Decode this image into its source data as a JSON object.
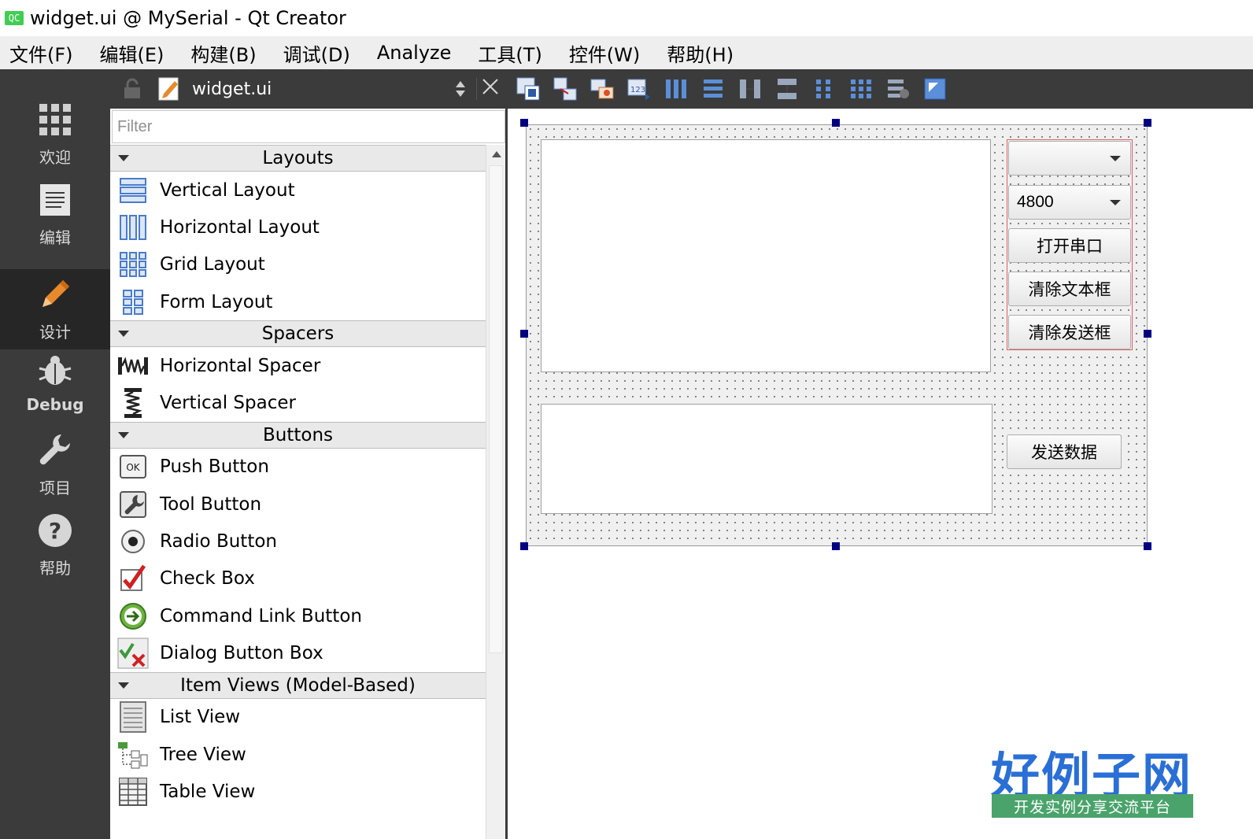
{
  "window": {
    "title": "widget.ui @ MySerial - Qt Creator",
    "app_badge": "QC"
  },
  "menu": [
    "文件(F)",
    "编辑(E)",
    "构建(B)",
    "调试(D)",
    "Analyze",
    "工具(T)",
    "控件(W)",
    "帮助(H)"
  ],
  "modes": [
    {
      "label": "欢迎",
      "icon": "grid-icon"
    },
    {
      "label": "编辑",
      "icon": "document-icon"
    },
    {
      "label": "设计",
      "icon": "pencil-icon",
      "active": true
    },
    {
      "label": "Debug",
      "icon": "bug-icon"
    },
    {
      "label": "项目",
      "icon": "wrench-icon"
    },
    {
      "label": "帮助",
      "icon": "help-icon"
    }
  ],
  "editor": {
    "file_name": "widget.ui"
  },
  "widget_box": {
    "filter_placeholder": "Filter",
    "categories": [
      {
        "name": "Layouts",
        "items": [
          "Vertical Layout",
          "Horizontal Layout",
          "Grid Layout",
          "Form Layout"
        ]
      },
      {
        "name": "Spacers",
        "items": [
          "Horizontal Spacer",
          "Vertical Spacer"
        ]
      },
      {
        "name": "Buttons",
        "items": [
          "Push Button",
          "Tool Button",
          "Radio Button",
          "Check Box",
          "Command Link Button",
          "Dialog Button Box"
        ]
      },
      {
        "name": "Item Views (Model-Based)",
        "items": [
          "List View",
          "Tree View",
          "Table View"
        ]
      }
    ]
  },
  "form": {
    "port_combo_value": "",
    "baud_combo_value": "4800",
    "open_port_label": "打开串口",
    "clear_text_label": "清除文本框",
    "clear_send_label": "清除发送框",
    "send_data_label": "发送数据"
  },
  "watermark": {
    "logo_text": "好例子网",
    "logo_subtext": "开发实例分享交流平台"
  },
  "colors": {
    "mode_bar": "#3b3b3b",
    "handle": "#000080",
    "accent": "#2a6fd6"
  }
}
